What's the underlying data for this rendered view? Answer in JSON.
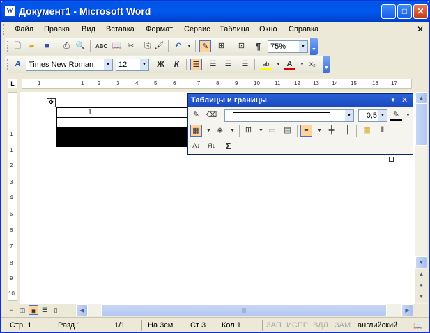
{
  "window": {
    "title": "Документ1 - Microsoft Word",
    "icon": "W"
  },
  "menu": {
    "items": [
      "Файл",
      "Правка",
      "Вид",
      "Вставка",
      "Формат",
      "Сервис",
      "Таблица",
      "Окно",
      "Справка"
    ]
  },
  "standard_toolbar": {
    "zoom": "75%",
    "pilcrow": "¶"
  },
  "format_toolbar": {
    "font": "Times New Roman",
    "size": "12",
    "bold": "Ж",
    "italic": "К",
    "styles_icon": "A",
    "font_color": "A",
    "subscript": "x₂"
  },
  "ruler": {
    "corner": "L",
    "labels": [
      "1",
      "1",
      "2",
      "3",
      "4",
      "5",
      "6",
      "7",
      "8",
      "9",
      "10",
      "11",
      "12",
      "13",
      "14",
      "15",
      "16",
      "17"
    ],
    "vlabels": [
      "1",
      "1",
      "2",
      "3",
      "4",
      "5",
      "6",
      "7",
      "8",
      "9",
      "10"
    ]
  },
  "document": {
    "table_cell": "1"
  },
  "float_toolbar": {
    "title": "Таблицы и границы",
    "line_weight": "0,5",
    "sigma": "Σ"
  },
  "statusbar": {
    "page": "Стр. 1",
    "section": "Разд 1",
    "pages": "1/1",
    "position": "На 3см",
    "line": "Ст 3",
    "column": "Кол 1",
    "rec": "ЗАП",
    "trk": "ИСПР",
    "ext": "ВДЛ",
    "ovr": "ЗАМ",
    "language": "английский"
  }
}
